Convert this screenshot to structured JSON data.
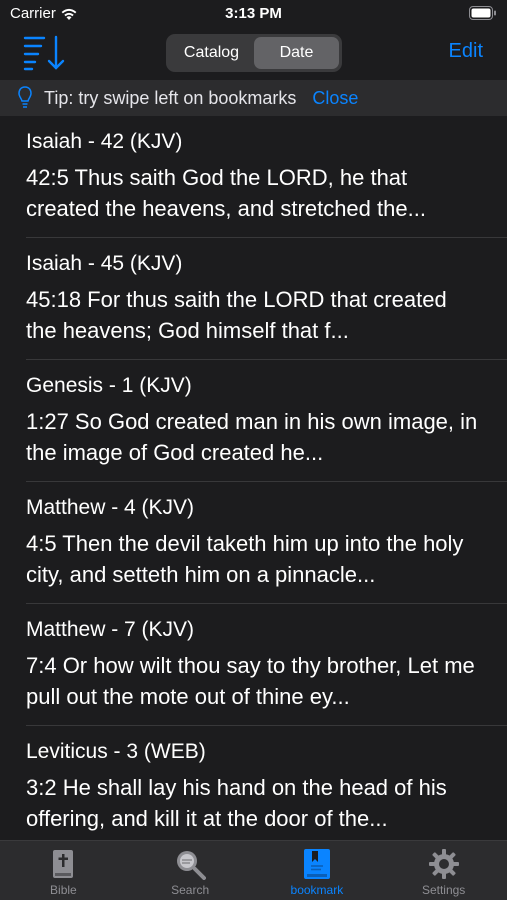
{
  "status": {
    "carrier": "Carrier",
    "time": "3:13 PM"
  },
  "nav": {
    "segments": [
      "Catalog",
      "Date"
    ],
    "active_segment": "Date",
    "edit_label": "Edit"
  },
  "tip": {
    "text": "Tip: try swipe left on bookmarks",
    "close_label": "Close"
  },
  "bookmarks": [
    {
      "title": "Isaiah - 42 (KJV)",
      "verse": "42:5  Thus saith God the LORD, he that created the heavens, and stretched the..."
    },
    {
      "title": "Isaiah - 45 (KJV)",
      "verse": "45:18  For thus saith the LORD that created the heavens; God himself that f..."
    },
    {
      "title": "Genesis - 1 (KJV)",
      "verse": "1:27  So God created man in his own image, in the image of God created he..."
    },
    {
      "title": "Matthew - 4 (KJV)",
      "verse": "4:5  Then the devil taketh him up into the holy city, and setteth him on a pinnacle..."
    },
    {
      "title": "Matthew - 7 (KJV)",
      "verse": "7:4  Or how wilt thou say to thy brother, Let me pull out the mote out of thine ey..."
    },
    {
      "title": "Leviticus - 3 (WEB)",
      "verse": "3:2  He shall lay his hand on the head of his offering, and kill it at the door of the..."
    }
  ],
  "tabs": [
    {
      "label": "Bible",
      "icon": "bible-icon"
    },
    {
      "label": "Search",
      "icon": "search-icon"
    },
    {
      "label": "bookmark",
      "icon": "bookmark-icon"
    },
    {
      "label": "Settings",
      "icon": "gear-icon"
    }
  ],
  "active_tab": "bookmark",
  "colors": {
    "accent": "#0a84ff",
    "background": "#1c1c1e",
    "bar": "#2c2c2e"
  }
}
